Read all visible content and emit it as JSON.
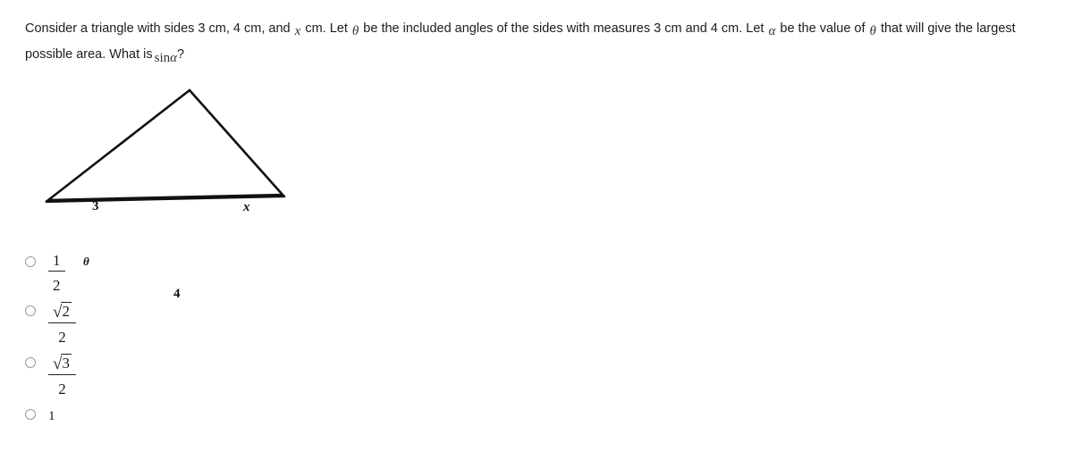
{
  "question": {
    "part1": "Consider a triangle with sides 3 cm, 4 cm, and",
    "var_x": "x",
    "part2": "cm. Let",
    "var_theta": "θ",
    "part3": "be the included angles of the sides with measures 3 cm and 4 cm. Let",
    "var_alpha": "α",
    "part4": "be the value of",
    "var_theta2": "θ",
    "part5": "that will give the largest possible area. What is",
    "expr_sin": "sin",
    "expr_alpha": "α",
    "part6": "?"
  },
  "figure": {
    "name": "triangle-diagram",
    "labels": {
      "side_left": "3",
      "side_right": "x",
      "angle": "θ",
      "side_base": "4"
    },
    "geometry": {
      "left_vertex": [
        54,
        139
      ],
      "apex": [
        212,
        16
      ],
      "right_vertex": [
        316,
        133
      ]
    },
    "stroke_color": "#111111"
  },
  "options": [
    {
      "id": "option-one-half",
      "kind": "fraction",
      "numerator": "1",
      "denominator": "2",
      "selected": false
    },
    {
      "id": "option-sqrt2-over-2",
      "kind": "fraction-radical",
      "surd": "√",
      "radicand": "2",
      "denominator": "2",
      "selected": false
    },
    {
      "id": "option-sqrt3-over-2",
      "kind": "fraction-radical",
      "surd": "√",
      "radicand": "3",
      "denominator": "2",
      "selected": false
    },
    {
      "id": "option-one",
      "kind": "plain",
      "value": "1",
      "selected": false
    }
  ],
  "colors": {
    "background": "#ffffff",
    "text": "#1c1c1c",
    "radio_border": "#9a9a9a",
    "rule": "#222222"
  }
}
